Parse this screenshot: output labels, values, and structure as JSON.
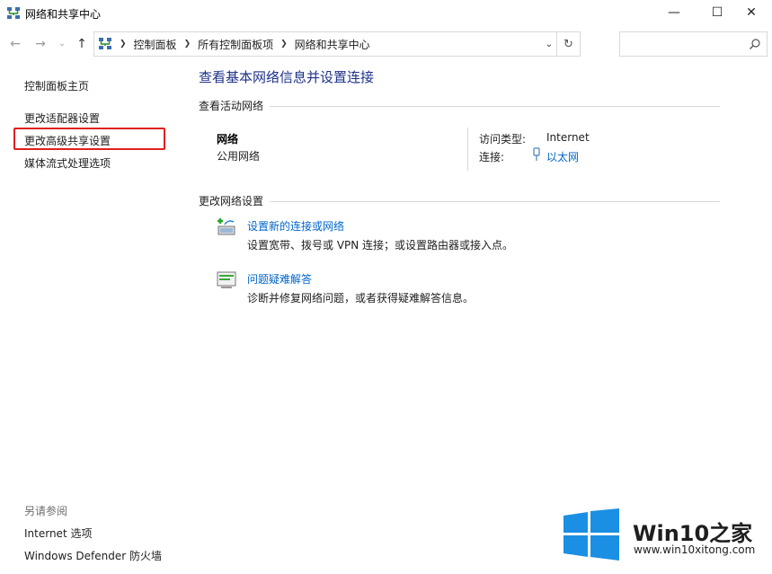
{
  "window": {
    "title": "网络和共享中心",
    "controls": {
      "minimize": "—",
      "maximize": "☐",
      "close": "✕"
    }
  },
  "address_bar": {
    "breadcrumbs": [
      "控制面板",
      "所有控制面板项",
      "网络和共享中心"
    ],
    "search_placeholder": ""
  },
  "left_nav": {
    "items": [
      "控制面板主页",
      "更改适配器设置",
      "更改高级共享设置",
      "媒体流式处理选项"
    ],
    "highlighted_item": "更改高级共享设置",
    "highlight_color": "#e02020",
    "see_also_title": "另请参阅",
    "see_also": [
      "Internet 选项",
      "Windows Defender 防火墙"
    ]
  },
  "main": {
    "title": "查看基本网络信息并设置连接",
    "active_networks_heading": "查看活动网络",
    "network": {
      "name": "网络",
      "type": "公用网络",
      "access_type_label": "访问类型:",
      "access_type_value": "Internet",
      "connection_label": "连接:",
      "connection_value": "以太网"
    },
    "change_settings_heading": "更改网络设置",
    "tasks": [
      {
        "link": "设置新的连接或网络",
        "desc": "设置宽带、拨号或 VPN 连接；或设置路由器或接入点。",
        "icon": "new-connection-icon"
      },
      {
        "link": "问题疑难解答",
        "desc": "诊断并修复网络问题，或者获得疑难解答信息。",
        "icon": "troubleshoot-icon"
      }
    ]
  },
  "watermark": {
    "brand": "Win10之家",
    "url": "www.win10xitong.com",
    "logo_color": "#1a8fe3"
  },
  "colors": {
    "title_blue": "#1e3287",
    "link_blue": "#0066cc"
  }
}
